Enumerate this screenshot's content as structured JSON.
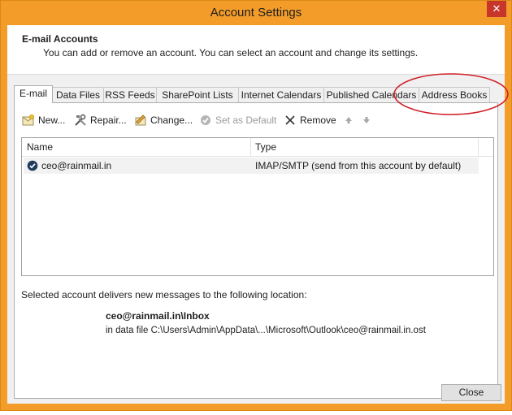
{
  "window": {
    "title": "Account Settings",
    "close_glyph": "✕"
  },
  "header": {
    "title": "E-mail Accounts",
    "description": "You can add or remove an account. You can select an account and change its settings."
  },
  "tabs": [
    {
      "label": "E-mail",
      "active": true
    },
    {
      "label": "Data Files",
      "active": false
    },
    {
      "label": "RSS Feeds",
      "active": false
    },
    {
      "label": "SharePoint Lists",
      "active": false
    },
    {
      "label": "Internet Calendars",
      "active": false
    },
    {
      "label": "Published Calendars",
      "active": false
    },
    {
      "label": "Address Books",
      "active": false
    }
  ],
  "toolbar": {
    "new_label": "New...",
    "repair_label": "Repair...",
    "change_label": "Change...",
    "set_default_label": "Set as Default",
    "remove_label": "Remove"
  },
  "accounts": {
    "columns": {
      "name": "Name",
      "type": "Type"
    },
    "rows": [
      {
        "name": "ceo@rainmail.in",
        "type": "IMAP/SMTP (send from this account by default)"
      }
    ]
  },
  "delivery": {
    "label": "Selected account delivers new messages to the following location:",
    "folder": "ceo@rainmail.in\\Inbox",
    "data_file": "in data file C:\\Users\\Admin\\AppData\\...\\Microsoft\\Outlook\\ceo@rainmail.in.ost"
  },
  "footer": {
    "close_label": "Close"
  },
  "colors": {
    "title_bar": "#f39c2a",
    "close_button": "#c7352b",
    "highlight_ellipse": "#d0202a"
  }
}
